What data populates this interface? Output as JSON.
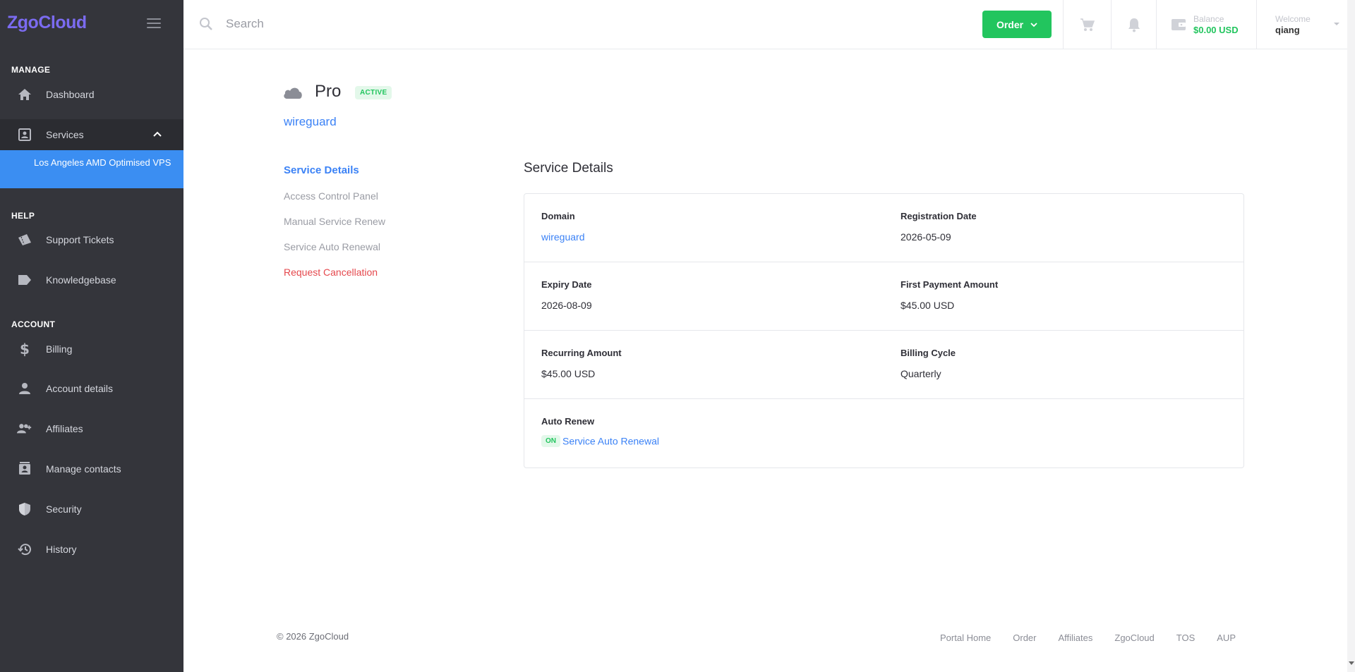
{
  "brand": "ZgoCloud",
  "sidebar": {
    "sections": {
      "manage": "MANAGE",
      "help": "HELP",
      "account": "ACCOUNT"
    },
    "items": {
      "dashboard": "Dashboard",
      "services": "Services",
      "services_sub": "Los Angeles AMD Optimised VPS",
      "support_tickets": "Support Tickets",
      "knowledgebase": "Knowledgebase",
      "billing": "Billing",
      "account_details": "Account details",
      "affiliates": "Affiliates",
      "manage_contacts": "Manage contacts",
      "security": "Security",
      "history": "History"
    }
  },
  "header": {
    "search_placeholder": "Search",
    "order_label": "Order",
    "balance_label": "Balance",
    "balance_value": "$0.00 USD",
    "welcome_label": "Welcome",
    "username": "qiang"
  },
  "service": {
    "name": "Pro",
    "status": "ACTIVE",
    "domain": "wireguard"
  },
  "subnav": {
    "service_details": "Service Details",
    "access_control_panel": "Access Control Panel",
    "manual_service_renew": "Manual Service Renew",
    "service_auto_renewal": "Service Auto Renewal",
    "request_cancellation": "Request Cancellation"
  },
  "details": {
    "title": "Service Details",
    "domain_label": "Domain",
    "domain_value": "wireguard",
    "registration_date_label": "Registration Date",
    "registration_date_value": "2026-05-09",
    "expiry_date_label": "Expiry Date",
    "expiry_date_value": "2026-08-09",
    "first_payment_label": "First Payment Amount",
    "first_payment_value": "$45.00 USD",
    "recurring_label": "Recurring Amount",
    "recurring_value": "$45.00 USD",
    "billing_cycle_label": "Billing Cycle",
    "billing_cycle_value": "Quarterly",
    "auto_renew_label": "Auto Renew",
    "auto_renew_status": "ON",
    "auto_renew_link": "Service Auto Renewal"
  },
  "footer": {
    "copyright": "© 2026 ZgoCloud",
    "links": {
      "portal_home": "Portal Home",
      "order": "Order",
      "affiliates": "Affiliates",
      "zgocloud": "ZgoCloud",
      "tos": "TOS",
      "aup": "AUP"
    }
  },
  "colors": {
    "sidebar_bg": "#34353b",
    "accent_blue": "#3b82f6",
    "accent_green": "#22c55e",
    "brand_purple": "#7b6bf0",
    "danger": "#e5484d"
  }
}
